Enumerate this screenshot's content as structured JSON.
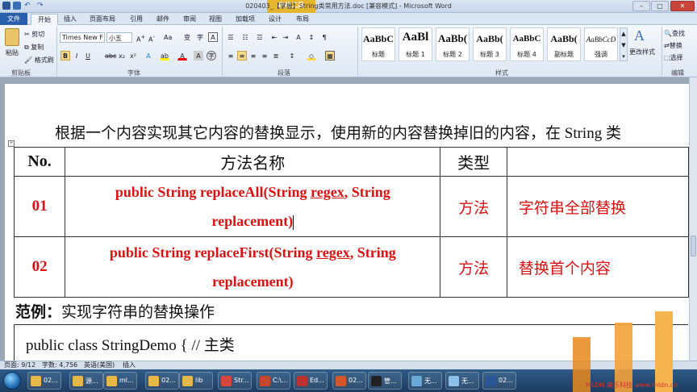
{
  "window": {
    "title": "020403_【掌握】String类常用方法.doc [兼容模式] - Microsoft Word",
    "context_group": "表格工具",
    "buttons": {
      "minimize": "–",
      "maximize": "□",
      "close": "✕"
    }
  },
  "tabs": [
    "文件",
    "开始",
    "插入",
    "页面布局",
    "引用",
    "邮件",
    "审阅",
    "视图",
    "加载项",
    "设计",
    "布局"
  ],
  "ribbon": {
    "clipboard": {
      "paste": "粘贴",
      "cut": "剪切",
      "copy": "复制",
      "format_painter": "格式刷",
      "label": "剪贴板"
    },
    "font": {
      "name": "Times New F",
      "size": "小五",
      "label": "字体"
    },
    "paragraph": {
      "label": "段落"
    },
    "styles": {
      "items": [
        {
          "sample": "AaBbC",
          "name": "标题"
        },
        {
          "sample": "AaBl",
          "name": "标题 1"
        },
        {
          "sample": "AaBb(",
          "name": "标题 2"
        },
        {
          "sample": "AaBb(",
          "name": "标题 3"
        },
        {
          "sample": "AaBbC",
          "name": "标题 4"
        },
        {
          "sample": "AaBb(",
          "name": "副标题"
        },
        {
          "sample": "AaBbCcD",
          "name": "强调"
        }
      ],
      "change_styles": "更改样式",
      "label": "样式"
    },
    "editing": {
      "find": "查找",
      "replace": "替换",
      "select": "选择",
      "label": "编辑"
    }
  },
  "document": {
    "intro": "根据一个内容实现其它内容的替换显示，使用新的内容替换掉旧的内容，在 String 类",
    "table": {
      "headers": [
        "No.",
        "方法名称",
        "类型",
        ""
      ],
      "rows": [
        {
          "no": "01",
          "sig1a": "public String replaceAll(String ",
          "sig1u": "regex",
          "sig1b": ", String",
          "sig2": "replacement)",
          "type": "方法",
          "desc": "字符串全部替换"
        },
        {
          "no": "02",
          "sig1a": "public String replaceFirst(String ",
          "sig1u": "regex",
          "sig1b": ", String",
          "sig2": "replacement)",
          "type": "方法",
          "desc": "替换首个内容"
        }
      ]
    },
    "example_label": "范例：",
    "example_text": "实现字符串的替换操作",
    "code_line": "public class StringDemo {     //  主类"
  },
  "status": {
    "page": "页面: 9/12",
    "words": "字数: 4,756",
    "language": "英语(美国)",
    "mode": "插入"
  },
  "taskbar": [
    {
      "label": "02...",
      "icon": "folder-icon",
      "color": "#e6b84a"
    },
    {
      "label": "源...",
      "icon": "folder-icon",
      "color": "#e6b84a"
    },
    {
      "label": "ml...",
      "icon": "folder-icon",
      "color": "#e6b84a"
    },
    {
      "label": "02...",
      "icon": "folder-icon",
      "color": "#e6b84a"
    },
    {
      "label": "lib",
      "icon": "folder-icon",
      "color": "#e6b84a"
    },
    {
      "label": "Str...",
      "icon": "chrome-icon",
      "color": "#d9453b"
    },
    {
      "label": "C:\\...",
      "icon": "terminal-icon",
      "color": "#c8462c"
    },
    {
      "label": "Ed...",
      "icon": "editplus-icon",
      "color": "#b33"
    },
    {
      "label": "02...",
      "icon": "powerpoint-icon",
      "color": "#d2572c"
    },
    {
      "label": "管...",
      "icon": "cmd-icon",
      "color": "#222"
    },
    {
      "label": "无...",
      "icon": "paint-icon",
      "color": "#6aa8d8"
    },
    {
      "label": "无...",
      "icon": "notepad-icon",
      "color": "#8cc0e8"
    },
    {
      "label": "02...",
      "icon": "word-icon",
      "color": "#2b5797"
    }
  ],
  "watermark": {
    "text": "MLDN 魔乐科技  www.mldn.cn",
    "colors": [
      "#e8881c",
      "#f2a23a",
      "#f6b44e"
    ]
  }
}
